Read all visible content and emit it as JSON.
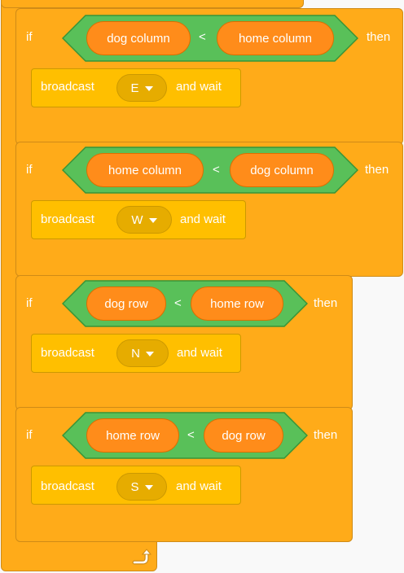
{
  "blocks": [
    {
      "if_label": "if",
      "left_reporter": "dog column",
      "operator": "<",
      "right_reporter": "home column",
      "then_label": "then",
      "broadcast_label": "broadcast",
      "message": "E",
      "and_wait_label": "and wait"
    },
    {
      "if_label": "if",
      "left_reporter": "home column",
      "operator": "<",
      "right_reporter": "dog column",
      "then_label": "then",
      "broadcast_label": "broadcast",
      "message": "W",
      "and_wait_label": "and wait"
    },
    {
      "if_label": "if",
      "left_reporter": "dog row",
      "operator": "<",
      "right_reporter": "home row",
      "then_label": "then",
      "broadcast_label": "broadcast",
      "message": "N",
      "and_wait_label": "and wait"
    },
    {
      "if_label": "if",
      "left_reporter": "home row",
      "operator": "<",
      "right_reporter": "dog row",
      "then_label": "then",
      "broadcast_label": "broadcast",
      "message": "S",
      "and_wait_label": "and wait"
    }
  ],
  "loop_icon": "loop-arrow-icon",
  "colors": {
    "control": "#ffab19",
    "event": "#ffbf00",
    "operator": "#59c059",
    "reporter": "#ff8c1a",
    "dropdown": "#e6ac00"
  }
}
